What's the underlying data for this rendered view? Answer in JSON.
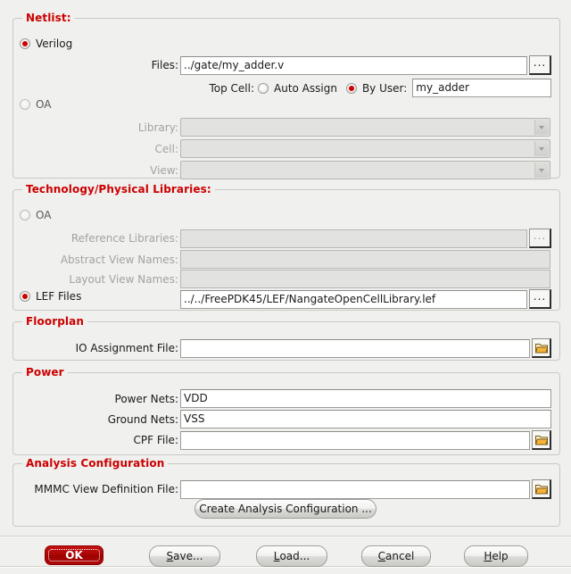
{
  "sections": {
    "netlist": {
      "title": "Netlist:",
      "verilog_radio": "Verilog",
      "files_label": "Files:",
      "files_value": "../gate/my_adder.v",
      "files_browse": "...",
      "top_cell_label": "Top Cell:",
      "auto_assign_label": "Auto Assign",
      "by_user_label": "By User:",
      "top_cell_value": "my_adder",
      "oa_radio": "OA",
      "library_label": "Library:",
      "library_value": "",
      "cell_label": "Cell:",
      "cell_value": "",
      "view_label": "View:",
      "view_value": ""
    },
    "technology": {
      "title": "Technology/Physical Libraries:",
      "oa_radio": "OA",
      "reference_libraries_label": "Reference Libraries:",
      "reference_libraries_value": "",
      "reference_libraries_browse": "...",
      "abstract_view_names_label": "Abstract View Names:",
      "abstract_view_names_value": "",
      "layout_view_names_label": "Layout View Names:",
      "layout_view_names_value": "",
      "lef_files_radio": "LEF Files",
      "lef_files_value": "../../FreePDK45/LEF/NangateOpenCellLibrary.lef",
      "lef_files_browse": "..."
    },
    "floorplan": {
      "title": "Floorplan",
      "io_assignment_label": "IO Assignment File:",
      "io_assignment_value": ""
    },
    "power": {
      "title": "Power",
      "power_nets_label": "Power Nets:",
      "power_nets_value": "VDD",
      "ground_nets_label": "Ground Nets:",
      "ground_nets_value": "VSS",
      "cpf_file_label": "CPF File:",
      "cpf_file_value": ""
    },
    "analysis": {
      "title": "Analysis Configuration",
      "mmmc_label": "MMMC View Definition File:",
      "mmmc_value": "",
      "create_button": "Create Analysis Configuration ..."
    }
  },
  "footer": {
    "ok": "OK",
    "save": "ave...",
    "save_mnemonic": "S",
    "load": "oad...",
    "load_mnemonic": "L",
    "cancel": "ancel",
    "cancel_mnemonic": "C",
    "help": "elp",
    "help_mnemonic": "H"
  },
  "colors": {
    "group_title": "#cc0000",
    "radio_selected": "#d00000",
    "ok_button": "#a90505",
    "background": "#f0f0ee"
  }
}
